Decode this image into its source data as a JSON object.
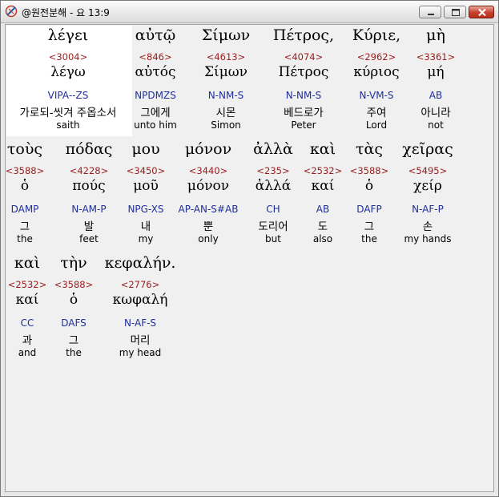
{
  "window": {
    "title": "@원전분해 - 요 13:9"
  },
  "icons": {
    "app": "app-logo-icon",
    "minimize": "minimize-icon",
    "maximize": "maximize-icon",
    "close": "close-icon"
  },
  "colors": {
    "strong_number": "#9b1c1c",
    "parsing": "#1f2f9c",
    "selected_background": "#ffffff"
  },
  "rows": [
    {
      "words": [
        {
          "greek": "λέγει",
          "number": "<3004>",
          "lexeme": "λέγω",
          "parsing": "VIPA--ZS",
          "korean": "가로되-씻겨 주옵소서",
          "english": "saith",
          "selected": true
        },
        {
          "greek": "αὐτῷ",
          "number": "<846>",
          "lexeme": "αὐτός",
          "parsing": "NPDMZS",
          "korean": "그에게",
          "english": "unto him"
        },
        {
          "greek": "Σίμων",
          "number": "<4613>",
          "lexeme": "Σίμων",
          "parsing": "N-NM-S",
          "korean": "시몬",
          "english": "Simon"
        },
        {
          "greek": "Πέτρος,",
          "number": "<4074>",
          "lexeme": "Πέτρος",
          "parsing": "N-NM-S",
          "korean": "베드로가",
          "english": "Peter"
        },
        {
          "greek": "Κύριε,",
          "number": "<2962>",
          "lexeme": "κύριος",
          "parsing": "N-VM-S",
          "korean": "주여",
          "english": "Lord"
        },
        {
          "greek": "μὴ",
          "number": "<3361>",
          "lexeme": "μή",
          "parsing": "AB",
          "korean": "아니라",
          "english": "not"
        }
      ]
    },
    {
      "words": [
        {
          "greek": "τοὺς",
          "number": "<3588>",
          "lexeme": "ὁ",
          "parsing": "DAMP",
          "korean": "그",
          "english": "the"
        },
        {
          "greek": "πόδας",
          "number": "<4228>",
          "lexeme": "πούς",
          "parsing": "N-AM-P",
          "korean": "발",
          "english": "feet"
        },
        {
          "greek": "μου",
          "number": "<3450>",
          "lexeme": "μοῦ",
          "parsing": "NPG-XS",
          "korean": "내",
          "english": "my"
        },
        {
          "greek": "μόνον",
          "number": "<3440>",
          "lexeme": "μόνον",
          "parsing": "AP-AN-S#AB",
          "korean": "뿐",
          "english": "only"
        },
        {
          "greek": "ἀλλὰ",
          "number": "<235>",
          "lexeme": "ἀλλά",
          "parsing": "CH",
          "korean": "도리어",
          "english": "but"
        },
        {
          "greek": "καὶ",
          "number": "<2532>",
          "lexeme": "καί",
          "parsing": "AB",
          "korean": "도",
          "english": "also"
        },
        {
          "greek": "τὰς",
          "number": "<3588>",
          "lexeme": "ὁ",
          "parsing": "DAFP",
          "korean": "그",
          "english": "the"
        },
        {
          "greek": "χεῖρας",
          "number": "<5495>",
          "lexeme": "χείρ",
          "parsing": "N-AF-P",
          "korean": "손",
          "english": "my hands"
        }
      ]
    },
    {
      "words": [
        {
          "greek": "καὶ",
          "number": "<2532>",
          "lexeme": "καί",
          "parsing": "CC",
          "korean": "과",
          "english": "and"
        },
        {
          "greek": "τὴν",
          "number": "<3588>",
          "lexeme": "ὁ",
          "parsing": "DAFS",
          "korean": "그",
          "english": "the"
        },
        {
          "greek": "κεφαλήν.",
          "number": "<2776>",
          "lexeme": "κωφαλή",
          "parsing": "N-AF-S",
          "korean": "머리",
          "english": "my head"
        }
      ]
    }
  ]
}
